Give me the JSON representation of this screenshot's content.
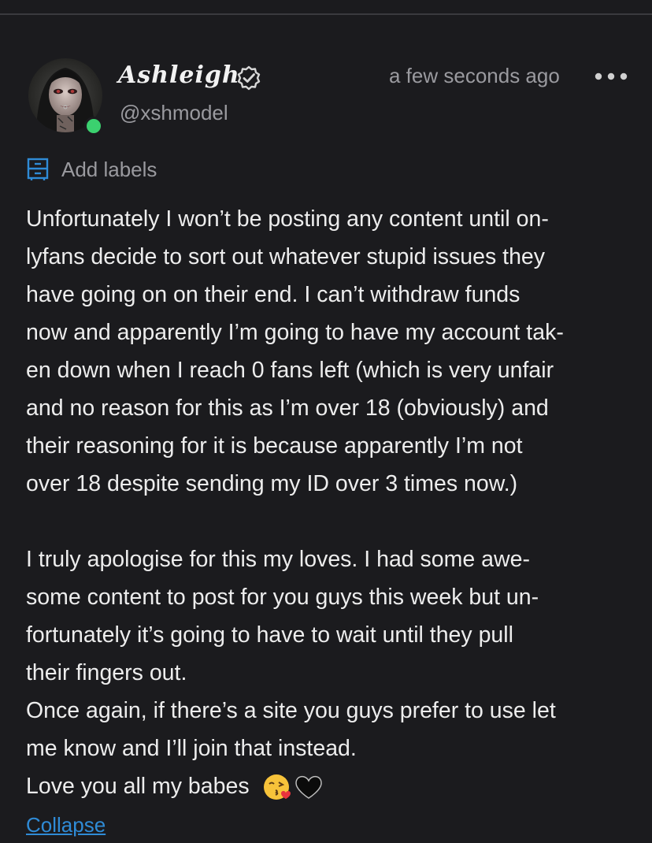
{
  "post": {
    "author": {
      "display_name": "Ashleigh",
      "handle": "@xshmodel",
      "verified": true,
      "online": true
    },
    "timestamp": "a few seconds ago",
    "add_labels": "Add labels",
    "body_lines": [
      "Unfortunately I won’t be posting any content until on-",
      "lyfans decide to sort out whatever stupid issues they",
      "have going on on their end. I can’t withdraw funds",
      "now and apparently I’m going to have my account tak-",
      "en down when I reach 0 fans left (which is very unfair",
      "and no reason for this as I’m over 18 (obviously) and",
      "their reasoning for it is because apparently I’m not",
      "over 18 despite sending my ID over 3 times now.)",
      "",
      "I truly apologise for this my loves. I had some awe-",
      "some content to post for you guys this week but un-",
      "fortunately it’s going to have to wait until they pull",
      "their fingers out.",
      "Once again, if there’s a site you guys prefer to use let",
      "me know and I’ll join that instead."
    ],
    "closing_line": "Love you all my babes",
    "closing_emojis": [
      "kissing-heart-emoji",
      "black-heart-emoji"
    ],
    "collapse_label": "Collapse"
  },
  "colors": {
    "background": "#1b1b1e",
    "text": "#ededed",
    "muted": "#9a9a9f",
    "link": "#2f8bd6",
    "online": "#3bd16f",
    "label_icon": "#2f8bd6"
  }
}
